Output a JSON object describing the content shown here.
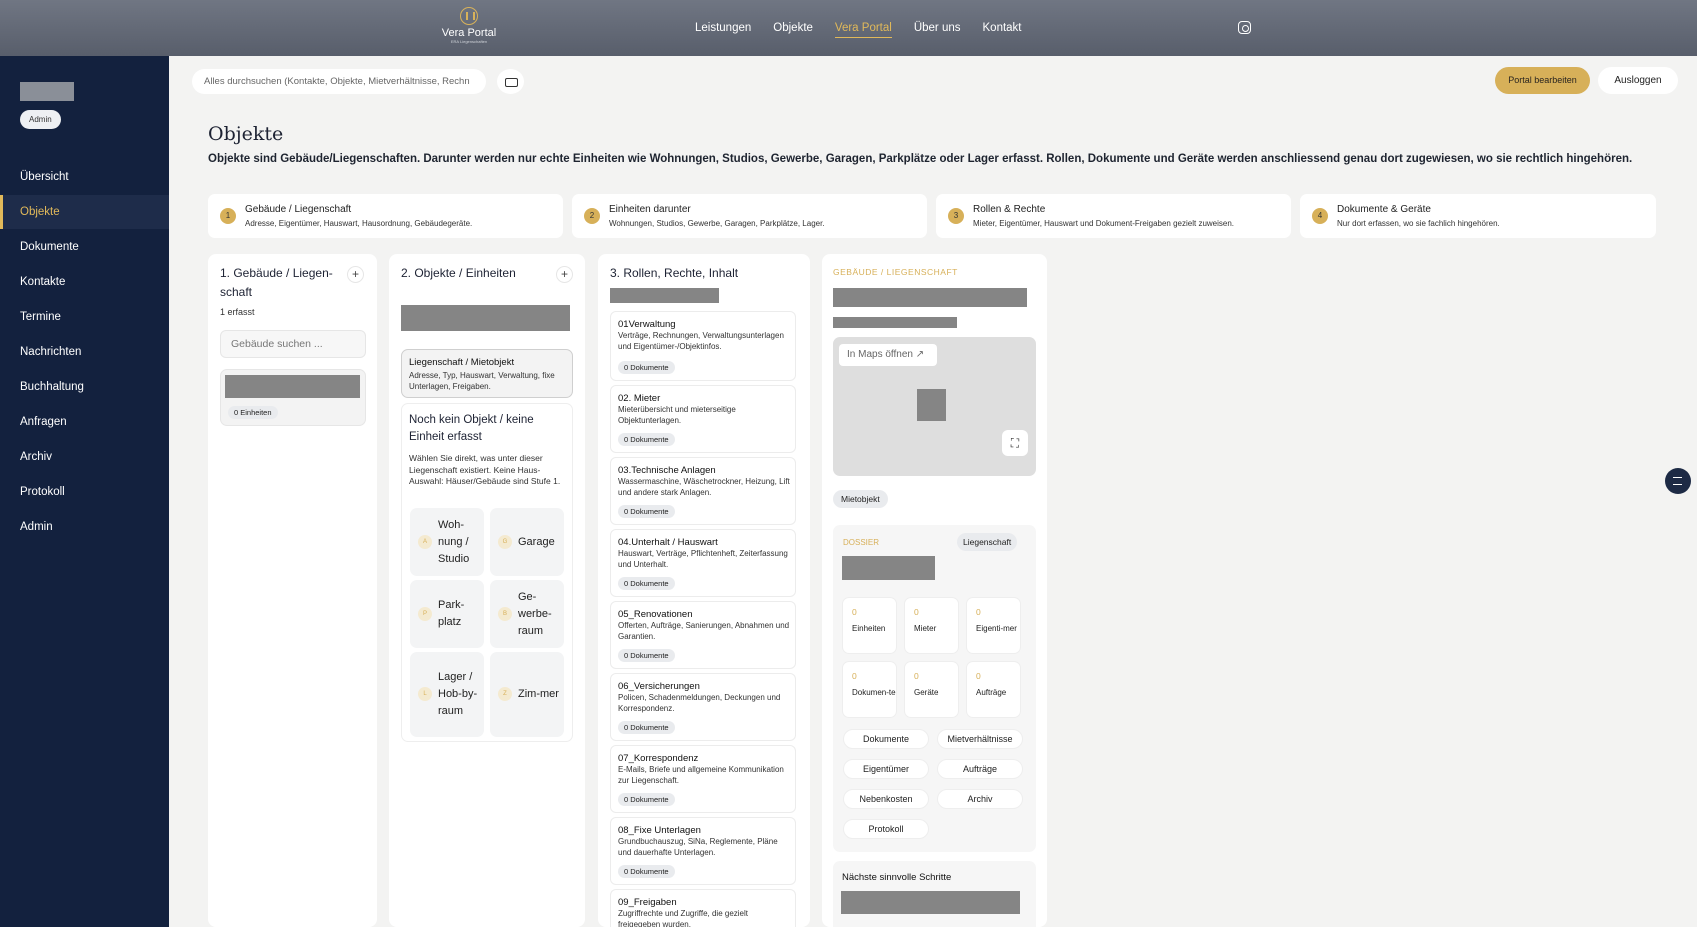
{
  "topbar": {
    "logo_title": "Vera Portal",
    "logo_sub": "ERA Liegenschaften",
    "nav": [
      "Leistungen",
      "Objekte",
      "Vera Portal",
      "Über uns",
      "Kontakt"
    ]
  },
  "sidebar": {
    "badge": "Admin",
    "items": [
      "Übersicht",
      "Objekte",
      "Dokumente",
      "Kontakte",
      "Termine",
      "Nachrichten",
      "Buchhaltung",
      "Anfragen",
      "Archiv",
      "Protokoll",
      "Admin"
    ]
  },
  "toolbar": {
    "search_placeholder": "Alles durchsuchen (Kontakte, Objekte, Mietverhältnisse, Rechn",
    "edit_label": "Portal bearbeiten",
    "logout_label": "Ausloggen"
  },
  "page": {
    "title": "Objekte",
    "intro": "Objekte sind Gebäude/Liegenschaften. Darunter werden nur echte Einheiten wie Wohnungen, Studios, Gewerbe, Garagen, Parkplätze oder Lager erfasst. Rollen, Dokumente und Geräte werden anschliessend genau dort zugewiesen, wo sie rechtlich hingehören."
  },
  "steps": [
    {
      "num": "1",
      "title": "Gebäude / Liegenschaft",
      "desc": "Adresse, Eigentümer, Hauswart, Hausordnung, Gebäudegeräte."
    },
    {
      "num": "2",
      "title": "Einheiten darunter",
      "desc": "Wohnungen, Studios, Gewerbe, Garagen, Parkplätze, Lager."
    },
    {
      "num": "3",
      "title": "Rollen & Rechte",
      "desc": "Mieter, Eigentümer, Hauswart und Dokument-Freigaben gezielt zuweisen."
    },
    {
      "num": "4",
      "title": "Dokumente & Geräte",
      "desc": "Nur dort erfassen, wo sie fachlich hingehören."
    }
  ],
  "col1": {
    "title_l1": "1. Gebäude / Liegen-",
    "title_l2": "schaft",
    "count": "1 erfasst",
    "search_placeholder": "Gebäude suchen ...",
    "units_pill": "0 Einheiten"
  },
  "col2": {
    "title": "2. Objekte / Einheiten",
    "selected_title": "Liegenschaft / Mietobjekt",
    "selected_desc": "Adresse, Typ, Hauswart, Verwaltung, fixe Unterlagen, Freigaben.",
    "empty_title": "Noch kein Objekt / keine Einheit erfasst",
    "empty_desc": "Wählen Sie direkt, was unter dieser Liegenschaft existiert. Keine Haus-Auswahl: Häuser/Gebäude sind Stufe 1.",
    "tiles": [
      {
        "icon": "A",
        "label": "Woh-nung / Studio"
      },
      {
        "icon": "G",
        "label": "Garage"
      },
      {
        "icon": "P",
        "label": "Park-platz"
      },
      {
        "icon": "B",
        "label": "Ge-werbe-raum"
      },
      {
        "icon": "L",
        "label": "Lager / Hob-by-raum"
      },
      {
        "icon": "Z",
        "label": "Zim-mer"
      }
    ]
  },
  "col3": {
    "title": "3. Rollen, Rechte, Inhalt",
    "folders": [
      {
        "title": "01Verwaltung",
        "desc": "Verträge, Rechnungen, Verwaltungsunterlagen und Eigentümer-/Objektinfos.",
        "docs": "0 Dokumente"
      },
      {
        "title": "02. Mieter",
        "desc": "Mieterübersicht und mieterseitige Objektunterlagen.",
        "docs": "0 Dokumente"
      },
      {
        "title": "03.Technische Anlagen",
        "desc": "Wassermaschine, Wäschetrockner, Heizung, Lift und andere stark Anlagen.",
        "docs": "0 Dokumente"
      },
      {
        "title": "04.Unterhalt / Hauswart",
        "desc": "Hauswart, Verträge, Pflichtenheft, Zeiterfassung und Unterhalt.",
        "docs": "0 Dokumente"
      },
      {
        "title": "05_Renovationen",
        "desc": "Offerten, Aufträge, Sanierungen, Abnahmen und Garantien.",
        "docs": "0 Dokumente"
      },
      {
        "title": "06_Versicherungen",
        "desc": "Policen, Schadenmeldungen, Deckungen und Korrespondenz.",
        "docs": "0 Dokumente"
      },
      {
        "title": "07_Korrespondenz",
        "desc": "E-Mails, Briefe und allgemeine Kommunikation zur Liegenschaft.",
        "docs": "0 Dokumente"
      },
      {
        "title": "08_Fixe Unterlagen",
        "desc": "Grundbuchauszug, SiNa, Reglemente, Pläne und dauerhafte Unterlagen.",
        "docs": "0 Dokumente"
      },
      {
        "title": "09_Freigaben",
        "desc": "Zugriffrechte und Zugriffe, die gezielt freigegeben wurden.",
        "docs": ""
      }
    ]
  },
  "col4": {
    "kicker": "GEBÄUDE / LIEGENSCHAFT",
    "maps_label": "In Maps öffnen",
    "type_pill": "Mietobjekt",
    "dossier_label": "DOSSIER",
    "dossier_pill": "Liegenschaft",
    "stats": [
      {
        "value": "0",
        "label": "Einheiten"
      },
      {
        "value": "0",
        "label": "Mieter"
      },
      {
        "value": "0",
        "label": "Eigenti-mer"
      },
      {
        "value": "0",
        "label": "Dokumen-te"
      },
      {
        "value": "0",
        "label": "Geräte"
      },
      {
        "value": "0",
        "label": "Aufträge"
      }
    ],
    "buttons": [
      "Dokumente",
      "Mietverhältnisse",
      "Eigentümer",
      "Aufträge",
      "Nebenkosten",
      "Archiv",
      "Protokoll"
    ],
    "next_title": "Nächste sinnvolle Schritte"
  }
}
